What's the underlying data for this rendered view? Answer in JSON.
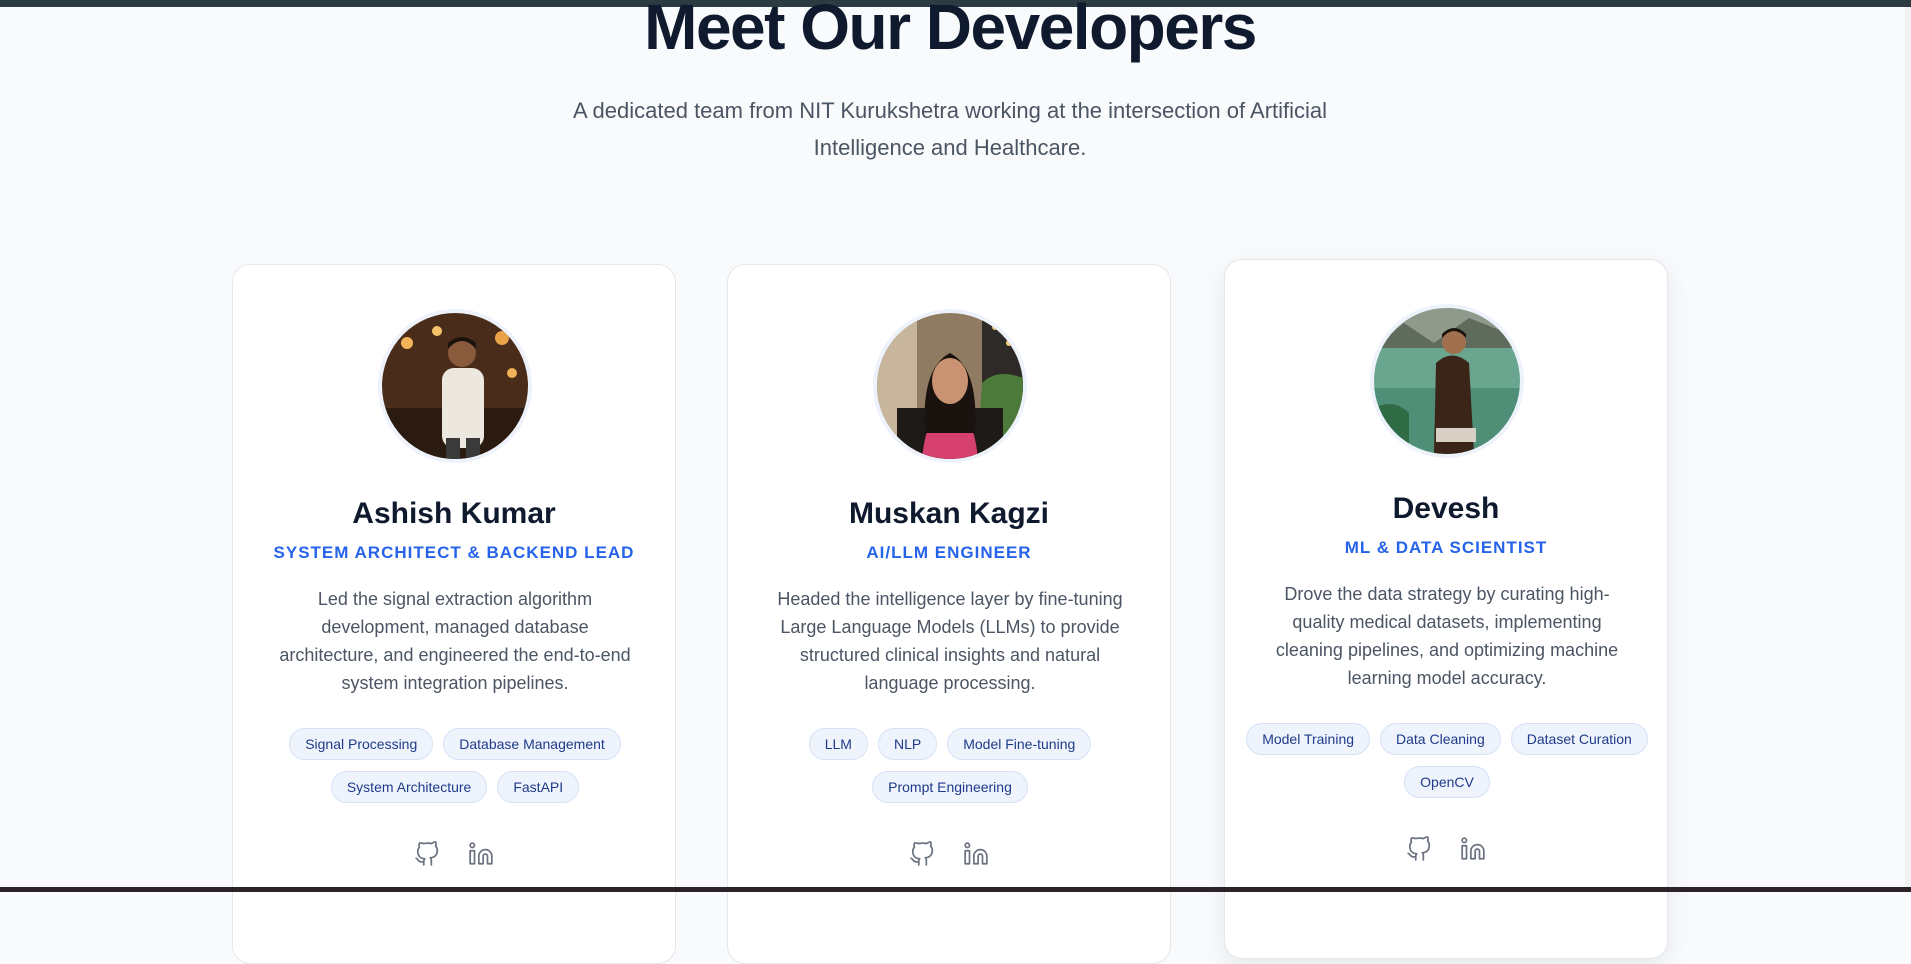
{
  "section": {
    "title": "Meet Our Developers",
    "subtitle": "A dedicated team from NIT Kurukshetra working at the intersection of Artificial Intelligence and Healthcare."
  },
  "colors": {
    "heading": "#0f1a2e",
    "accent": "#2563eb",
    "body_text": "#4b5563",
    "tag_bg": "#eff4fc",
    "tag_text": "#1e3a8a",
    "icon": "#6b7280"
  },
  "developers": [
    {
      "name": "Ashish Kumar",
      "role": "SYSTEM ARCHITECT & BACKEND LEAD",
      "bio": "Led the signal extraction algorithm development, managed database architecture, and engineered the end-to-end system integration pipelines.",
      "tags": [
        "Signal Processing",
        "Database Management",
        "System Architecture",
        "FastAPI"
      ],
      "social_icons": [
        "github-icon",
        "linkedin-icon"
      ]
    },
    {
      "name": "Muskan Kagzi",
      "role": "AI/LLM ENGINEER",
      "bio": "Headed the intelligence layer by fine-tuning Large Language Models (LLMs) to provide structured clinical insights and natural language processing.",
      "tags": [
        "LLM",
        "NLP",
        "Model Fine-tuning",
        "Prompt Engineering"
      ],
      "social_icons": [
        "github-icon",
        "linkedin-icon"
      ]
    },
    {
      "name": "Devesh",
      "role": "ML & DATA SCIENTIST",
      "bio": "Drove the data strategy by curating high-quality medical datasets, implementing cleaning pipelines, and optimizing machine learning model accuracy.",
      "tags": [
        "Model Training",
        "Data Cleaning",
        "Dataset Curation",
        "OpenCV"
      ],
      "social_icons": [
        "github-icon",
        "linkedin-icon"
      ]
    }
  ]
}
